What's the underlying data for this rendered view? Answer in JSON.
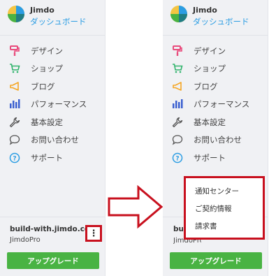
{
  "brand": {
    "name": "Jimdo",
    "dashboard_label": "ダッシュボード"
  },
  "menu": {
    "items": [
      {
        "label": "デザイン",
        "icon": "paint-roller-icon",
        "color": "#e94b7c"
      },
      {
        "label": "ショップ",
        "icon": "shopping-cart-icon",
        "color": "#2fb36b"
      },
      {
        "label": "ブログ",
        "icon": "megaphone-icon",
        "color": "#f5a623"
      },
      {
        "label": "パフォーマンス",
        "icon": "bar-chart-icon",
        "color": "#3a5fd0"
      },
      {
        "label": "基本設定",
        "icon": "wrench-icon",
        "color": "#555555"
      },
      {
        "label": "お問い合わせ",
        "icon": "chat-bubble-icon",
        "color": "#555555"
      },
      {
        "label": "サポート",
        "icon": "help-circle-icon",
        "color": "#2b9de3"
      }
    ]
  },
  "site": {
    "domain": "build-with.jimdo.com",
    "plan": "JimdoPro"
  },
  "upgrade_label": "アップグレード",
  "dropdown": {
    "items": [
      "通知センター",
      "ご契約情報",
      "請求書"
    ]
  },
  "right_site": {
    "domain_clipped": "build-with.jimdo.com",
    "plan_clipped": "JimdoPro"
  },
  "colors": {
    "accent_blue": "#2b9de3",
    "upgrade_green": "#49b343",
    "highlight_red": "#c8101e"
  }
}
